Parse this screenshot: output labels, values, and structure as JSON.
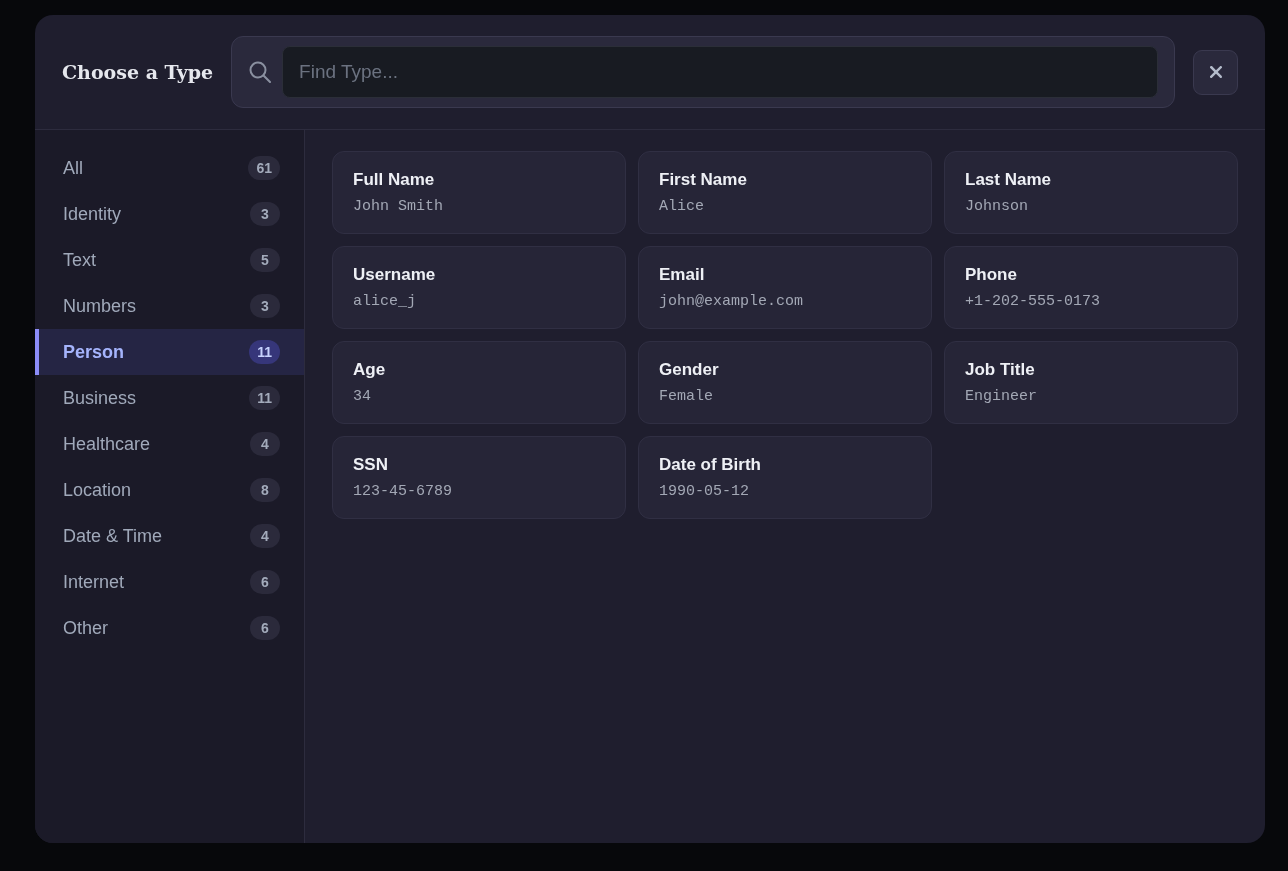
{
  "dialog": {
    "title": "Choose a Type",
    "search": {
      "placeholder": "Find Type..."
    }
  },
  "categories": [
    {
      "label": "All",
      "count": "61",
      "selected": false
    },
    {
      "label": "Identity",
      "count": "3",
      "selected": false
    },
    {
      "label": "Text",
      "count": "5",
      "selected": false
    },
    {
      "label": "Numbers",
      "count": "3",
      "selected": false
    },
    {
      "label": "Person",
      "count": "11",
      "selected": true
    },
    {
      "label": "Business",
      "count": "11",
      "selected": false
    },
    {
      "label": "Healthcare",
      "count": "4",
      "selected": false
    },
    {
      "label": "Location",
      "count": "8",
      "selected": false
    },
    {
      "label": "Date & Time",
      "count": "4",
      "selected": false
    },
    {
      "label": "Internet",
      "count": "6",
      "selected": false
    },
    {
      "label": "Other",
      "count": "6",
      "selected": false
    }
  ],
  "types": [
    {
      "name": "Full Name",
      "example": "John Smith"
    },
    {
      "name": "First Name",
      "example": "Alice"
    },
    {
      "name": "Last Name",
      "example": "Johnson"
    },
    {
      "name": "Username",
      "example": "alice_j"
    },
    {
      "name": "Email",
      "example": "john@example.com"
    },
    {
      "name": "Phone",
      "example": "+1-202-555-0173"
    },
    {
      "name": "Age",
      "example": "34"
    },
    {
      "name": "Gender",
      "example": "Female"
    },
    {
      "name": "Job Title",
      "example": "Engineer"
    },
    {
      "name": "SSN",
      "example": "123-45-6789"
    },
    {
      "name": "Date of Birth",
      "example": "1990-05-12"
    }
  ]
}
